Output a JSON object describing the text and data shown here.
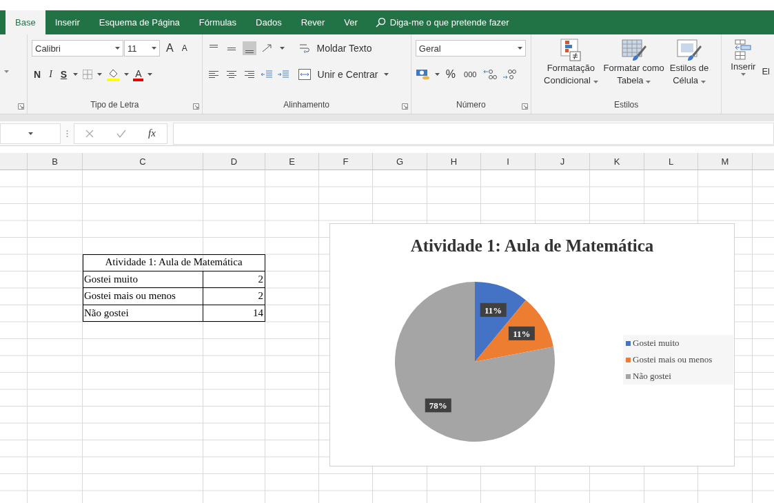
{
  "tabs": [
    {
      "label": "Base",
      "selected": true
    },
    {
      "label": "Inserir",
      "selected": false
    },
    {
      "label": "Esquema de Página",
      "selected": false
    },
    {
      "label": "Fórmulas",
      "selected": false
    },
    {
      "label": "Dados",
      "selected": false
    },
    {
      "label": "Rever",
      "selected": false
    },
    {
      "label": "Ver",
      "selected": false
    }
  ],
  "tell_me": {
    "placeholder": "Diga-me o que pretende fazer"
  },
  "ribbon": {
    "font": {
      "label": "Tipo de Letra",
      "font_name": "Calibri",
      "font_size": "11",
      "grow": "A",
      "shrink": "A",
      "bold": "N",
      "italic": "I",
      "underline": "S",
      "font_color": "A"
    },
    "alignment": {
      "label": "Alinhamento",
      "vertical": [
        {
          "selected": false
        },
        {
          "selected": false
        },
        {
          "selected": true
        }
      ],
      "wrap": "Moldar Texto",
      "merge": "Unir e Centrar"
    },
    "number": {
      "label": "Número",
      "format": "Geral",
      "percent": "%",
      "thousands": "000"
    },
    "styles": {
      "label": "Estilos",
      "buttons": [
        {
          "kind": "conditional",
          "lines": [
            "Formatação",
            "Condicional"
          ]
        },
        {
          "kind": "table",
          "lines": [
            "Formatar como",
            "Tabela"
          ]
        },
        {
          "kind": "cell",
          "lines": [
            "Estilos de",
            "Célula"
          ]
        }
      ]
    },
    "cells": {
      "insert": "Inserir",
      "cut_label": "El"
    }
  },
  "formula_bar": {
    "function_label": "fx"
  },
  "columns": [
    "B",
    "C",
    "D",
    "E",
    "F",
    "G",
    "H",
    "I",
    "J",
    "K",
    "L",
    "M"
  ],
  "table": {
    "title": "Atividade 1: Aula de Matemática",
    "rows": [
      {
        "label": "Gostei muito",
        "value": "2"
      },
      {
        "label": "Gostei mais ou menos",
        "value": "2"
      },
      {
        "label": "Não gostei",
        "value": "14"
      }
    ]
  },
  "chart": {
    "chart_data": {
      "type": "pie",
      "title": "Atividade 1: Aula de Matemática",
      "categories": [
        "Gostei muito",
        "Gostei mais ou menos",
        "Não gostei"
      ],
      "values": [
        11,
        11,
        78
      ],
      "colors": [
        "#4472c4",
        "#ed7d31",
        "#a5a5a5"
      ],
      "value_labels": [
        "11%",
        "11%",
        "78%"
      ]
    }
  }
}
